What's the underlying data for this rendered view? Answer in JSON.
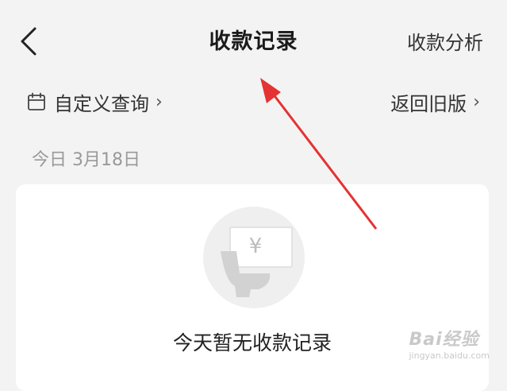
{
  "header": {
    "title": "收款记录",
    "right_link": "收款分析",
    "back_icon": "chevron-left-icon"
  },
  "filters": {
    "custom_query_label": "自定义查询",
    "custom_query_chevron": "›",
    "old_version_label": "返回旧版",
    "old_version_chevron": "›",
    "calendar_icon": "calendar-icon"
  },
  "date_section": {
    "label": "今日 3月18日"
  },
  "empty_state": {
    "icon": "yuan-illustration-icon",
    "symbol": "¥",
    "message": "今天暂无收款记录"
  },
  "annotation": {
    "arrow_color": "#e53232"
  },
  "watermark": {
    "line1": "Bai经验",
    "line2": "jingyan.baidu.com"
  }
}
